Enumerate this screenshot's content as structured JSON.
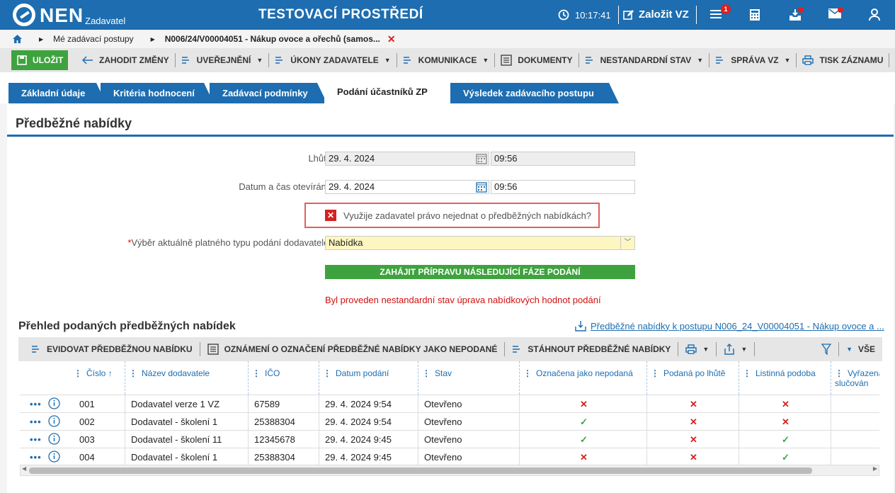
{
  "topbar": {
    "logo_text": "NEN",
    "logo_sub": "Zadavatel",
    "environment": "TESTOVACÍ PROSTŘEDÍ",
    "time": "10:17:41",
    "zalozit_label": "Založit VZ",
    "menu_badge": "1"
  },
  "breadcrumb": {
    "item1": "Mé zadávací postupy",
    "item2": "N006/24/V00004051 - Nákup ovoce a ořechů (samos...",
    "close": "✕"
  },
  "toolbar": {
    "save": "ULOŽIT",
    "discard": "ZAHODIT ZMĚNY",
    "publish": "UVEŘEJNĚNÍ",
    "acts": "ÚKONY ZADAVATELE",
    "comm": "KOMUNIKACE",
    "docs": "DOKUMENTY",
    "nonstd": "NESTANDARDNÍ STAV",
    "manage": "SPRÁVA VZ",
    "print": "TISK ZÁZNAMU"
  },
  "tabs": [
    "Základní údaje",
    "Kritéria hodnocení",
    "Zadávací podmínky",
    "Podání účastníků ZP",
    "Výsledek zadávacího postupu"
  ],
  "section": {
    "title": "Předběžné nabídky",
    "lhuta_label": "Lhůta",
    "lhuta_date": "29. 4. 2024",
    "lhuta_time": "09:56",
    "open_label": "Datum a čas otevírání:",
    "open_date": "29. 4. 2024",
    "open_time": "09:56",
    "warn_text": "Využije zadavatel právo nejednat o předběžných nabídkách?",
    "type_label": "Výběr aktuálně platného typu podání dodavatele:",
    "type_value": "Nabídka",
    "start_button": "ZAHÁJIT PŘÍPRAVU NÁSLEDUJÍCÍ FÁZE PODÁNÍ",
    "red_message": "Byl proveden nestandardní stav úprava nabídkových hodnot podání"
  },
  "grid": {
    "title": "Přehled podaných předběžných nabídek",
    "download_link": "Předběžné nabídky k postupu N006_24_V00004051 - Nákup ovoce a ...",
    "tb_evidovat": "EVIDOVAT PŘEDBĚŽNOU NABÍDKU",
    "tb_oznameni": "OZNÁMENÍ O OZNAČENÍ PŘEDBĚŽNÉ NABÍDKY JAKO NEPODANÉ",
    "tb_stahnout": "STÁHNOUT PŘEDBĚŽNÉ NABÍDKY",
    "tb_vse": "VŠE",
    "columns": [
      "Číslo",
      "Název dodavatele",
      "IČO",
      "Datum podání",
      "Stav",
      "Označena jako nepodaná",
      "Podaná po lhůtě",
      "Listinná podoba",
      "Vyřazena slučován"
    ],
    "sort_arrow": "↑",
    "rows": [
      {
        "cislo": "001",
        "nazev": "Dodavatel verze 1 VZ",
        "ico": "67589",
        "datum": "29. 4. 2024 9:54",
        "stav": "Otevřeno",
        "nepodana": "✕",
        "polhute": "✕",
        "listinna": "✕"
      },
      {
        "cislo": "002",
        "nazev": "Dodavatel - školení 1",
        "ico": "25388304",
        "datum": "29. 4. 2024 9:54",
        "stav": "Otevřeno",
        "nepodana": "✓",
        "polhute": "✕",
        "listinna": "✕"
      },
      {
        "cislo": "003",
        "nazev": "Dodavatel - školení 11",
        "ico": "12345678",
        "datum": "29. 4. 2024 9:45",
        "stav": "Otevřeno",
        "nepodana": "✓",
        "polhute": "✕",
        "listinna": "✓"
      },
      {
        "cislo": "004",
        "nazev": "Dodavatel - školení 1",
        "ico": "25388304",
        "datum": "29. 4. 2024 9:45",
        "stav": "Otevřeno",
        "nepodana": "✕",
        "polhute": "✕",
        "listinna": "✓"
      }
    ]
  },
  "colors": {
    "brand": "#1d6db0",
    "green": "#3ea33e",
    "red": "#d62020"
  }
}
